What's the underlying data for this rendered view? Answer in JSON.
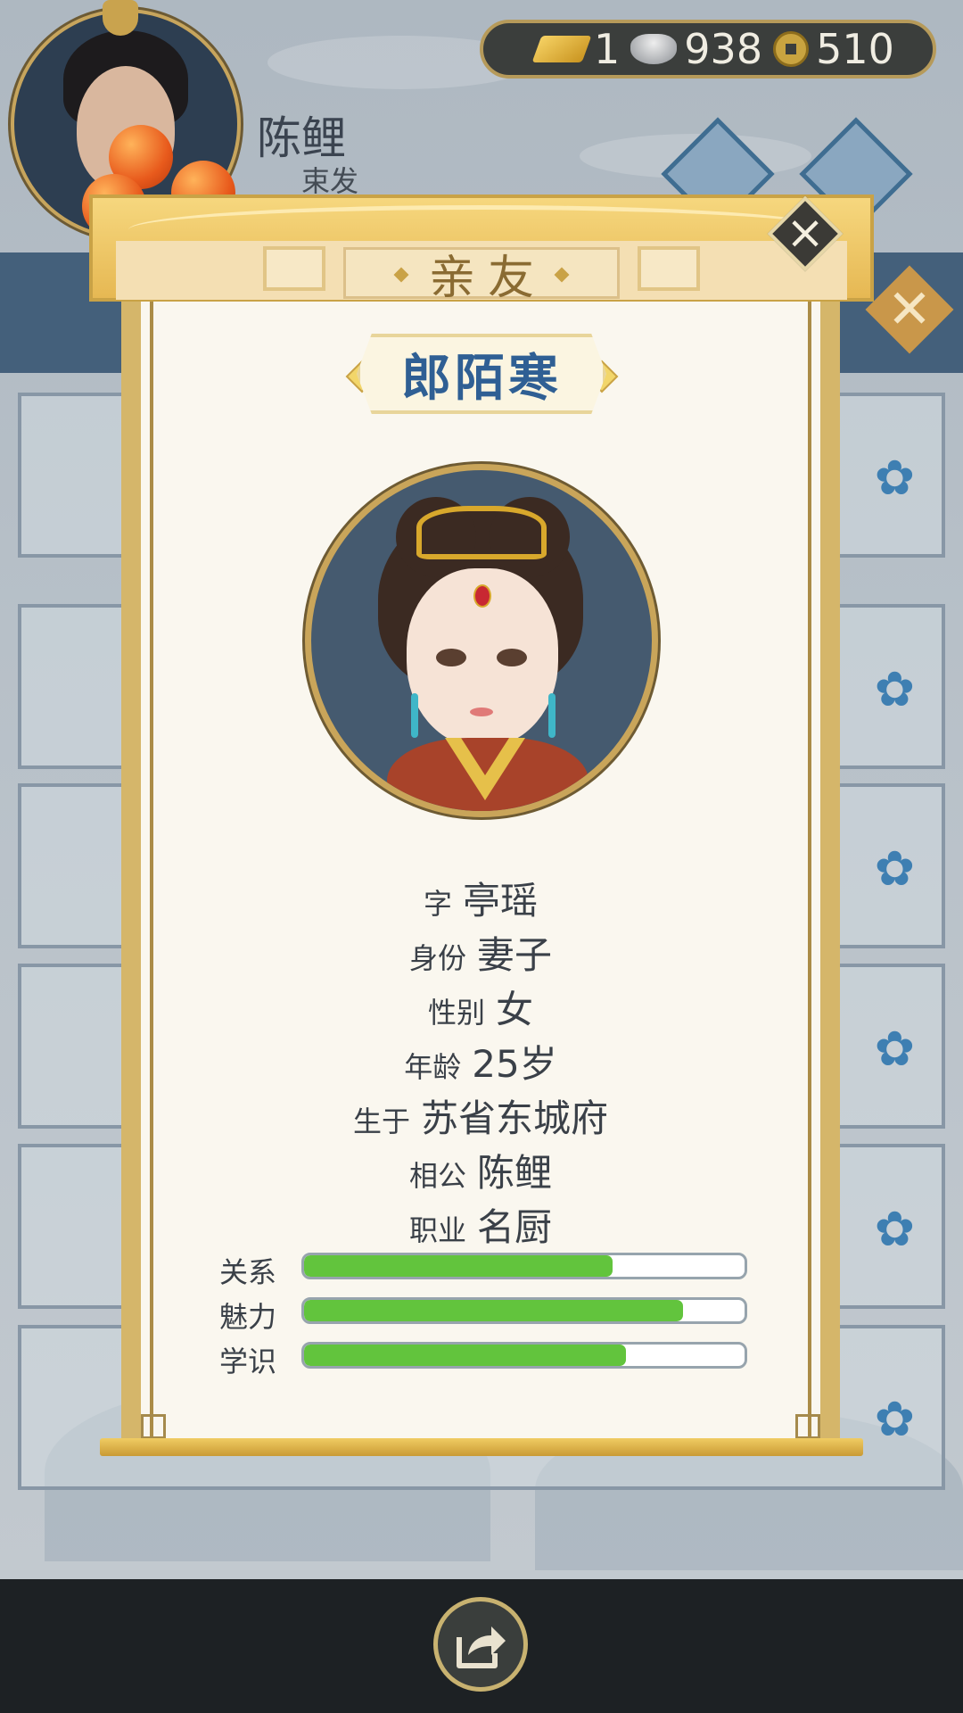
{
  "player": {
    "name": "陈鲤",
    "rank": "束发"
  },
  "currency": {
    "gold": "1",
    "silver": "938",
    "coins": "510"
  },
  "dialog": {
    "title": "亲友",
    "person_name": "郎陌寒",
    "info": [
      {
        "label": "字",
        "value": "亭瑶"
      },
      {
        "label": "身份",
        "value": "妻子"
      },
      {
        "label": "性别",
        "value": "女"
      },
      {
        "label": "年龄",
        "value": "25岁"
      },
      {
        "label": "生于",
        "value": "苏省东城府"
      },
      {
        "label": "相公",
        "value": "陈鲤"
      },
      {
        "label": "职业",
        "value": "名厨"
      }
    ],
    "stats": [
      {
        "label": "关系",
        "fill": 0.7
      },
      {
        "label": "魅力",
        "fill": 0.86
      },
      {
        "label": "学识",
        "fill": 0.73
      }
    ]
  },
  "icons": {
    "close": "close-icon",
    "share": "share-icon",
    "flower": "flower-icon",
    "gold": "gold-ingot-icon",
    "silver": "silver-ingot-icon",
    "coin": "copper-coin-icon"
  },
  "colors": {
    "accent_gold": "#c9a246",
    "name_blue": "#2f5f94",
    "bar_green": "#62c43d"
  }
}
